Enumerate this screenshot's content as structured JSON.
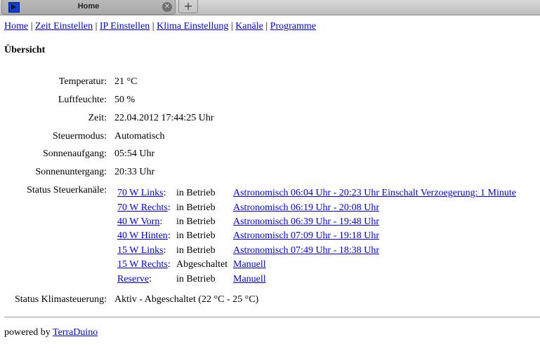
{
  "browser": {
    "tab_title": "Home",
    "close_glyph": "✕",
    "new_tab_glyph": "+"
  },
  "nav": {
    "links": [
      "Home",
      "Zeit Einstellen",
      "IP Einstellen",
      "Klima Einstellung",
      "Kanäle",
      "Programme"
    ],
    "separator": "|"
  },
  "page": {
    "heading": "Übersicht",
    "rows": [
      {
        "label": "Temperatur:",
        "value": "21 °C"
      },
      {
        "label": "Luftfeuchte:",
        "value": "50 %"
      },
      {
        "label": "Zeit:",
        "value": "22.04.2012 17:44:25 Uhr"
      },
      {
        "label": "Steuermodus:",
        "value": "Automatisch"
      },
      {
        "label": "Sonnenaufgang:",
        "value": "05:54 Uhr"
      },
      {
        "label": "Sonnenuntergang:",
        "value": "20:33 Uhr"
      }
    ],
    "channels_label": "Status Steuerkanäle:",
    "channels": [
      {
        "name": "70 W Links",
        "suffix": ":",
        "state": "in Betrieb",
        "program": "Astronomisch 06:04 Uhr - 20:23 Uhr Einschalt Verzoegerung: 1 Minute"
      },
      {
        "name": "70 W Rechts",
        "suffix": ":",
        "state": "in Betrieb",
        "program": "Astronomisch 06:19 Uhr - 20:08 Uhr"
      },
      {
        "name": "40 W Vorn",
        "suffix": ":",
        "state": "in Betrieb",
        "program": "Astronomisch 06:39 Uhr - 19:48 Uhr"
      },
      {
        "name": "40 W Hinten",
        "suffix": ":",
        "state": "in Betrieb",
        "program": "Astronomisch 07:09 Uhr - 19:18 Uhr"
      },
      {
        "name": "15 W Links",
        "suffix": ":",
        "state": "in Betrieb",
        "program": "Astronomisch 07:49 Uhr - 18:38 Uhr"
      },
      {
        "name": "15 W Rechts",
        "suffix": ":",
        "state": "Abgeschaltet",
        "program": "Manuell"
      },
      {
        "name": "Reserve",
        "suffix": ":",
        "state": "in Betrieb",
        "program": "Manuell"
      }
    ],
    "climate_label": "Status Klimasteuerung:",
    "climate_value": "Aktiv - Abgeschaltet (22 °C - 25 °C)"
  },
  "footer": {
    "prefix": "powered by",
    "link": "TerraDuino"
  },
  "colors": {
    "link": "#0000ee",
    "favicon": "#0a3fd8"
  },
  "icons": {
    "favicon": "terraduino-favicon-icon",
    "close": "close-icon",
    "new_tab": "plus-icon"
  }
}
